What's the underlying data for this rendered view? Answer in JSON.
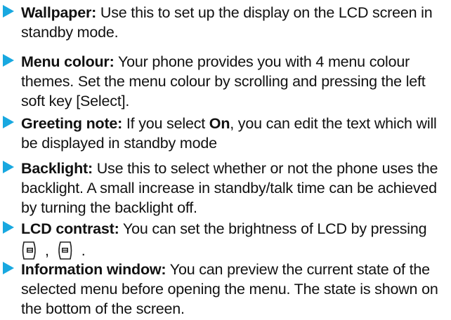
{
  "items": [
    {
      "term": "Wallpaper:",
      "line1": " Use this to set up the display on the LCD screen in",
      "line2": "standby mode."
    },
    {
      "term": "Menu colour:",
      "line1": " Your phone provides you with 4 menu colour",
      "line2": "themes. Set the menu colour by scrolling and pressing the left",
      "line3": "soft key [Select]."
    },
    {
      "term": "Greeting note:",
      "line1a": " If you select ",
      "strong": "On",
      "line1b": ", you can edit the text which will",
      "line2": "be displayed in standby mode"
    },
    {
      "term": "Backlight:",
      "line1": " Use this to select whether or not the phone uses the",
      "line2": "backlight. A small increase in standby/talk time can be achieved",
      "line3": "by turning the backlight off."
    },
    {
      "term": "LCD contrast:",
      "line1": " You can set the brightness of LCD by pressing",
      "comma": ",",
      "period": "."
    },
    {
      "term": "Information window:",
      "line1": " You can preview the current state of the",
      "line2": "selected menu before opening the menu. The state is shown on",
      "line3": "the bottom of the screen."
    }
  ],
  "bullet_color": "#18a8e0",
  "icons": [
    "left-soft-key-icon",
    "right-soft-key-icon"
  ]
}
